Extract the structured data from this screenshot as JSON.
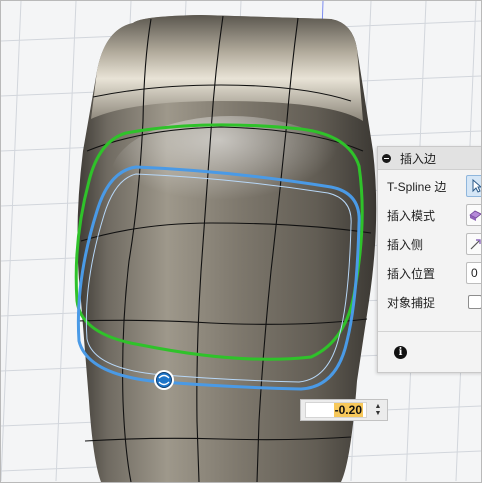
{
  "dialog": {
    "title": "插入边",
    "rows": [
      {
        "label": "T-Spline 边",
        "control": "select-button-icon"
      },
      {
        "label": "插入模式",
        "control": "mode-icon"
      },
      {
        "label": "插入侧",
        "control": "side-icon"
      },
      {
        "label": "插入位置",
        "value": "0"
      },
      {
        "label": "对象捕捉",
        "control": "checkbox"
      }
    ]
  },
  "value_input": {
    "value": "-0.20"
  },
  "colors": {
    "green_edge": "#2fc22a",
    "blue_edge": "#4a9ae6",
    "accent_highlight": "#f7c85a",
    "model_dark": "#4d4a44",
    "model_light": "#cfc9bc"
  }
}
